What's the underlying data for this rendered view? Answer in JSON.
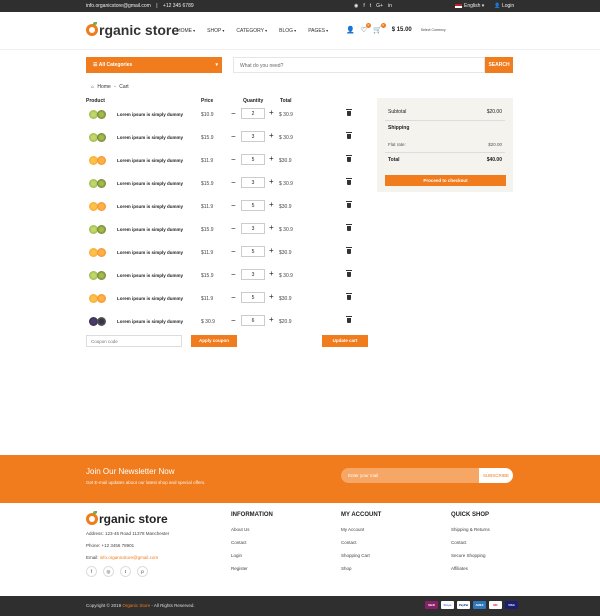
{
  "topbar": {
    "email": "info.organicstore@gmail.com",
    "sep": "|",
    "phone": "+12 345 6789",
    "social": [
      "f-icon",
      "t-icon",
      "y-icon",
      "g-icon",
      "in-icon"
    ],
    "social_glyphs": [
      "◉",
      "f",
      "t",
      "G+",
      "in"
    ],
    "language": "English",
    "login": "Login"
  },
  "header": {
    "logo_rest": "rganic store",
    "nav": [
      "HOME",
      "SHOP",
      "CATEGORY",
      "BLOG",
      "PAGES"
    ],
    "wishlist_count": "0",
    "cart_count": "0",
    "cart_total": "$ 15.00",
    "currency_label": "Select Currency"
  },
  "search": {
    "all_categories": "All Categories",
    "placeholder": "What do you need?",
    "button": "SEARCH"
  },
  "breadcrumb": {
    "home": "Home",
    "sep": "-",
    "current": "Cart"
  },
  "cart": {
    "headers": {
      "product": "Product",
      "price": "Price",
      "quantity": "Quantity",
      "total": "Total"
    },
    "rows": [
      {
        "name": "Lorem ipsum is simply dummy",
        "price": "$10.9",
        "qty": "2",
        "total": "$ 30.9",
        "fruit": "kiwi"
      },
      {
        "name": "Lorem ipsum is simply dummy",
        "price": "$15.9",
        "qty": "3",
        "total": "$ 30.9",
        "fruit": "kiwi"
      },
      {
        "name": "Lorem ipsum is simply dummy",
        "price": "$11.9",
        "qty": "5",
        "total": "$30.9",
        "fruit": "orange"
      },
      {
        "name": "Lorem ipsum is simply dummy",
        "price": "$15.9",
        "qty": "3",
        "total": "$ 30.9",
        "fruit": "kiwi"
      },
      {
        "name": "Lorem ipsum is simply dummy",
        "price": "$11.9",
        "qty": "5",
        "total": "$30.9",
        "fruit": "orange"
      },
      {
        "name": "Lorem ipsum is simply dummy",
        "price": "$15.9",
        "qty": "3",
        "total": "$ 30.9",
        "fruit": "kiwi"
      },
      {
        "name": "Lorem ipsum is simply dummy",
        "price": "$11.9",
        "qty": "5",
        "total": "$30.9",
        "fruit": "orange"
      },
      {
        "name": "Lorem ipsum is simply dummy",
        "price": "$15.9",
        "qty": "3",
        "total": "$ 30.9",
        "fruit": "kiwi"
      },
      {
        "name": "Lorem ipsum is simply dummy",
        "price": "$11.9",
        "qty": "5",
        "total": "$30.9",
        "fruit": "orange"
      },
      {
        "name": "Lorem ipsum is simply dummy",
        "price": "$ 30.9",
        "qty": "6",
        "total": "$20.9",
        "fruit": "blackberry"
      }
    ],
    "minus": "−",
    "plus": "+",
    "coupon_placeholder": "Coupon code",
    "apply_label": "Apply coupon",
    "update_label": "Update cart"
  },
  "summary": {
    "subtotal_label": "Subtotal",
    "subtotal_value": "$20.00",
    "shipping_label": "Shipping",
    "flat_rate_label": "Flat rate:",
    "flat_rate_value": "$20.00",
    "total_label": "Total",
    "total_value": "$40.00",
    "checkout_label": "Proceed to checkout"
  },
  "newsletter": {
    "title": "Join Our Newsletter Now",
    "subtitle": "Get E-mail updates about our latest shop and special offers.",
    "placeholder": "Enter your mail",
    "button": "SUBSCRIBE"
  },
  "footer": {
    "logo_rest": "rganic store",
    "address": "Address: 123-45 Road 11378 Manchester",
    "phone": "Phone: +12 3456 78901",
    "email": "info.organicstore@gmail.com",
    "social_glyphs": [
      "f",
      "◎",
      "t",
      "p"
    ],
    "columns": [
      {
        "title": "INFORMATION",
        "links": [
          "About Us",
          "Contact",
          "Login",
          "Register"
        ]
      },
      {
        "title": "MY ACCOUNT",
        "links": [
          "My Account",
          "Contact",
          "Shopping Cart",
          "Shop"
        ]
      },
      {
        "title": "QUICK SHOP",
        "links": [
          "Shipping & Returns",
          "Contact",
          "Secure Shopping",
          "Affiliates"
        ]
      }
    ],
    "copyright_pre": "Copyright © 2019",
    "copyright_brand": "Organic Store",
    "copyright_post": "- All Rights Reserved.",
    "payments": [
      "Skrill",
      "Stripe",
      "PayPal",
      "AMEX",
      "MC",
      "VISA"
    ]
  },
  "colors": {
    "accent": "#f07c1d",
    "dark": "#2f2f2f",
    "summary_bg": "#f4f3ee"
  }
}
